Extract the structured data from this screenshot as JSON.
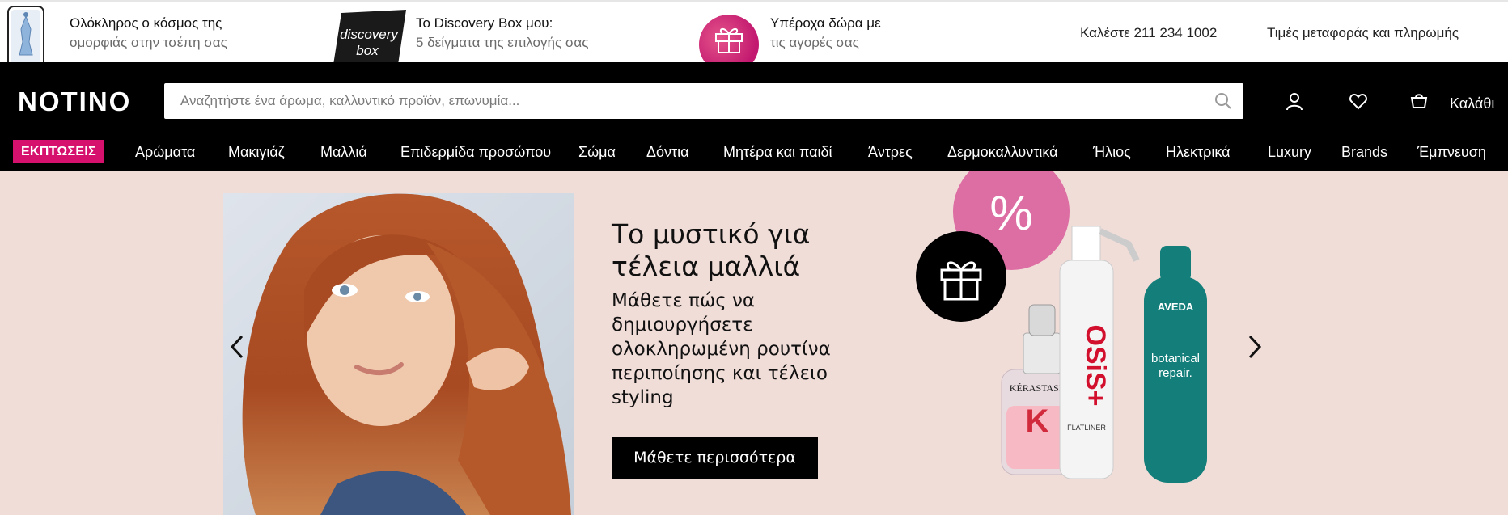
{
  "promo_bar": {
    "items": [
      {
        "title": "Ολόκληρος ο κόσμος της",
        "subtitle": "ομορφιάς στην τσέπη σας",
        "icon": "phone-app-icon"
      },
      {
        "title": "To Discovery Box μου:",
        "subtitle": "5 δείγματα της επιλογής σας",
        "icon": "discovery-box-icon",
        "box_text_1": "discovery",
        "box_text_2": "box"
      },
      {
        "title": "Υπέροχα δώρα με",
        "subtitle": "τις αγορές σας",
        "icon": "gift-icon"
      }
    ],
    "call_link": "Καλέστε 211 234 1002",
    "shipping_link": "Τιμές μεταφοράς και πληρωμής"
  },
  "header": {
    "logo": "NOTINO",
    "search_placeholder": "Αναζητήστε ένα άρωμα, καλλυντικό προϊόν, επωνυμία...",
    "search_value": "",
    "cart_label": "Καλάθι"
  },
  "nav": {
    "sale_label": "ΕΚΠΤΩΣΕΙΣ",
    "items": [
      "Αρώματα",
      "Μακιγιάζ",
      "Μαλλιά",
      "Επιδερμίδα προσώπου",
      "Σώμα",
      "Δόντια",
      "Μητέρα και παιδί",
      "Άντρες",
      "Δερμοκαλλυντικά",
      "Ήλιος",
      "Ηλεκτρικά",
      "Luxury",
      "Brands",
      "Έμπνευση"
    ]
  },
  "hero": {
    "title": "Το μυστικό για τέλεια μαλλιά",
    "description": "Μάθετε πώς να δημιουργήσετε ολοκληρωμένη ρουτίνα περιποίησης και τέλειο styling",
    "cta": "Μάθετε περισσότερα",
    "discount_badge": "%",
    "products": {
      "kerastase_brand": "KÉRASTASE",
      "kerastase_letter": "K",
      "osis_brand": "OSiS+",
      "osis_sub": "FLATLINER",
      "aveda_brand": "AVEDA",
      "aveda_line1": "botanical",
      "aveda_line2": "repair."
    }
  },
  "colors": {
    "brand_black": "#000000",
    "sale_pink": "#d6106d",
    "hero_bg": "#f1ddd8",
    "gift_pink": "#c2186f"
  }
}
